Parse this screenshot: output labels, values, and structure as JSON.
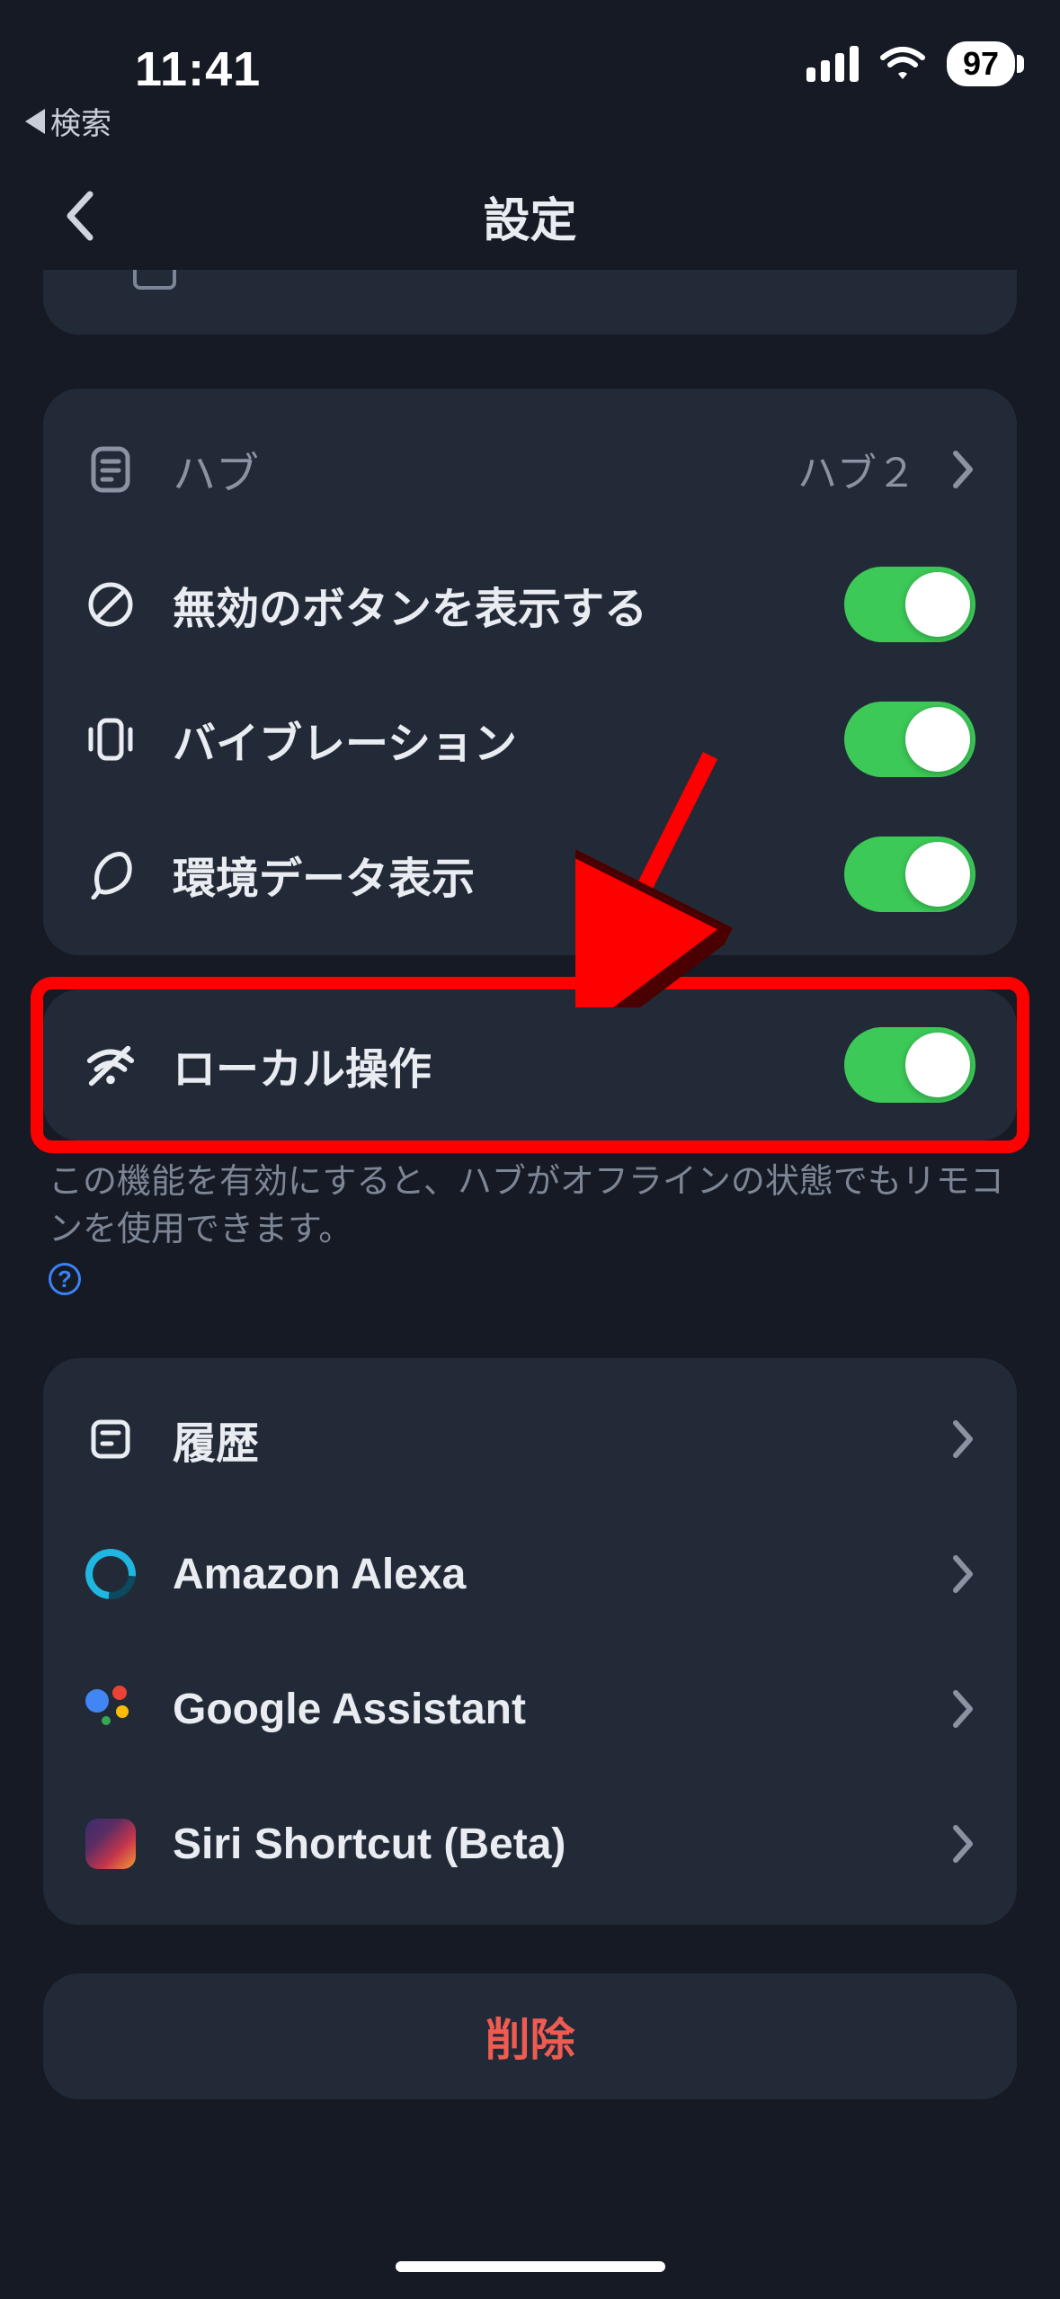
{
  "status": {
    "time": "11:41",
    "back_app": "検索",
    "battery": "97"
  },
  "nav": {
    "title": "設定"
  },
  "hub_row": {
    "label": "ハブ",
    "value": "ハブ２"
  },
  "toggles": {
    "show_disabled": {
      "label": "無効のボタンを表示する",
      "on": true
    },
    "vibration": {
      "label": "バイブレーション",
      "on": true
    },
    "env_data": {
      "label": "環境データ表示",
      "on": true
    },
    "local_ops": {
      "label": "ローカル操作",
      "on": true
    }
  },
  "footnote": {
    "text": "この機能を有効にすると、ハブがオフラインの状態でもリモコンを使用できます。"
  },
  "integrations": {
    "history": "履歴",
    "alexa": "Amazon Alexa",
    "gassist": "Google Assistant",
    "siri": "Siri Shortcut (Beta)"
  },
  "delete": {
    "label": "削除"
  }
}
